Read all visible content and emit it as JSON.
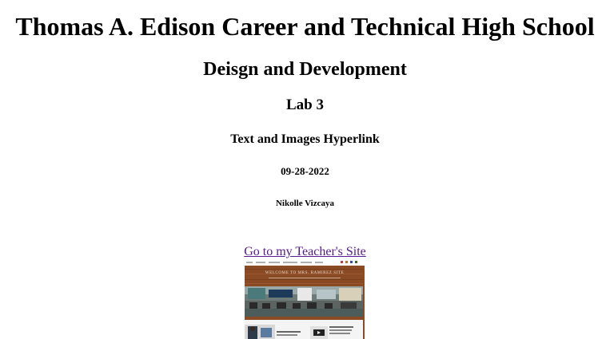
{
  "heading1": "Thomas A. Edison Career and Technical High School",
  "heading2": "Deisgn and Development",
  "heading3": "Lab 3",
  "heading4": "Text and Images Hyperlink",
  "heading5": "09-28-2022",
  "heading6": "Nikolle Vizcaya",
  "link": {
    "text": "Go to my Teacher's Site",
    "color": "#551a8b"
  },
  "thumbnail": {
    "alt": "Teacher site screenshot",
    "banner_text": "WELCOME TO MRS. RAMIREZ SITE"
  }
}
